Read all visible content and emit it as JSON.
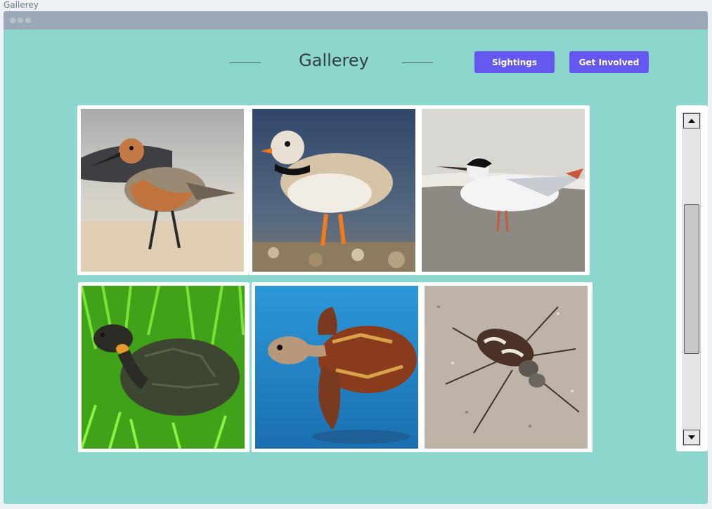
{
  "document": {
    "label": "Gallerey"
  },
  "header": {
    "title": "Gallerey"
  },
  "nav": {
    "sightings_label": "Sightings",
    "get_involved_label": "Get Involved"
  },
  "colors": {
    "background": "#8cd6cd",
    "accent": "#6458f0",
    "titlebar": "#9aa8b7"
  },
  "gallery": {
    "items": [
      {
        "subject": "red-knot-sandpiper"
      },
      {
        "subject": "piping-plover"
      },
      {
        "subject": "least-tern"
      },
      {
        "subject": "bog-turtle"
      },
      {
        "subject": "hawksbill-sea-turtle"
      },
      {
        "subject": "tiger-beetle"
      }
    ]
  }
}
